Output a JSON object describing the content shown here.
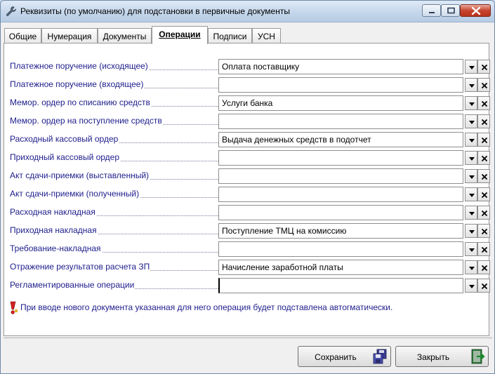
{
  "window": {
    "title": "Реквизиты (по умолчанию) для подстановки в первичные документы"
  },
  "tabs": [
    {
      "label": "Общие",
      "active": false
    },
    {
      "label": "Нумерация",
      "active": false
    },
    {
      "label": "Документы",
      "active": false
    },
    {
      "label": "Операции",
      "active": true
    },
    {
      "label": "Подписи",
      "active": false
    },
    {
      "label": "УСН",
      "active": false
    }
  ],
  "rows": [
    {
      "label": "Платежное поручение (исходящее)",
      "value": "Оплата поставщику"
    },
    {
      "label": "Платежное поручение (входящее)",
      "value": ""
    },
    {
      "label": "Мемор. ордер по списанию средств",
      "value": "Услуги банка"
    },
    {
      "label": "Мемор. ордер на поступление средств",
      "value": ""
    },
    {
      "label": "Расходный кассовый ордер",
      "value": "Выдача денежных средств в подотчет"
    },
    {
      "label": "Приходный кассовый ордер",
      "value": ""
    },
    {
      "label": "Акт сдачи-приемки (выставленный)",
      "value": ""
    },
    {
      "label": "Акт сдачи-приемки (полученный)",
      "value": ""
    },
    {
      "label": "Расходная накладная",
      "value": ""
    },
    {
      "label": "Приходная накладная",
      "value": "Поступление ТМЦ на комиссию"
    },
    {
      "label": "Требование-накладная",
      "value": ""
    },
    {
      "label": "Отражение результатов расчета ЗП",
      "value": "Начисление заработной платы"
    },
    {
      "label": "Регламентированные операции",
      "value": ""
    }
  ],
  "note": "При вводе нового документа указанная для него операция будет подставлена автогматически.",
  "buttons": {
    "save": "Сохранить",
    "close": "Закрыть"
  },
  "icons": {
    "title": "wrench-icon",
    "note": "exclamation-icon",
    "save": "floppy-disk-icon",
    "close": "exit-door-icon"
  }
}
